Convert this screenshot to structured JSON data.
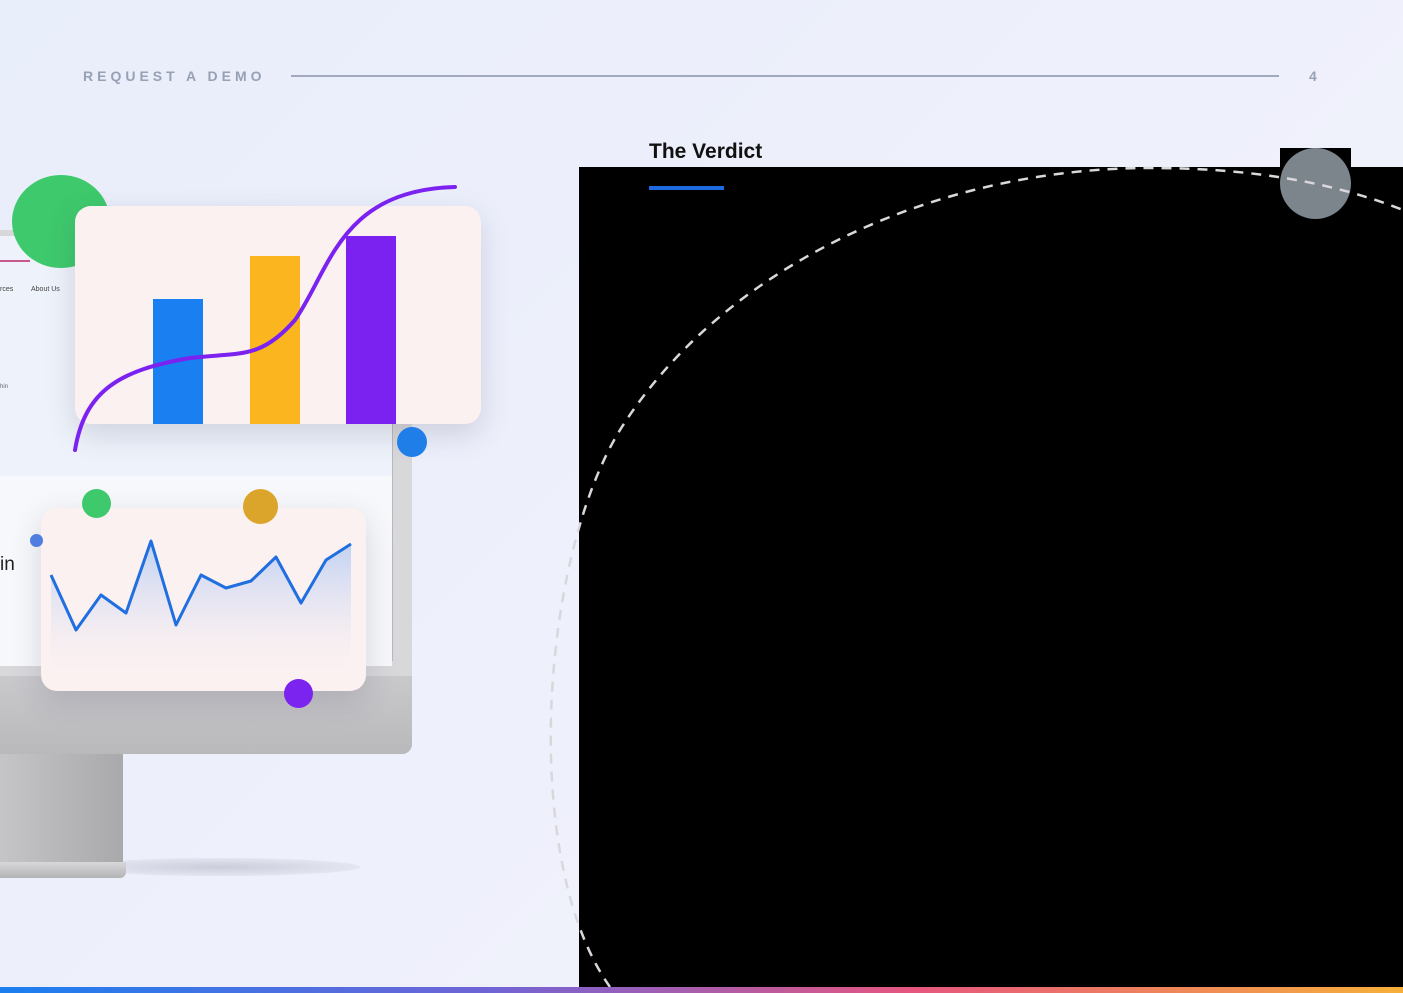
{
  "header": {
    "label": "REQUEST A DEMO",
    "page_number": "4"
  },
  "section": {
    "title": "The Verdict"
  },
  "illustration": {
    "screen_nav": [
      "rces",
      "About Us"
    ],
    "screen_small_text": "hin",
    "screen_big_text": "in"
  },
  "colors": {
    "accent_blue": "#1f6ae0",
    "bar_blue": "#1a7ff0",
    "bar_yellow": "#fbb61f",
    "bar_purple": "#7b22f0",
    "line_blue": "#1f6fe0",
    "green": "#3ec96c"
  },
  "chart_data": [
    {
      "type": "bar",
      "categories": [
        "",
        "",
        ""
      ],
      "values": [
        125,
        168,
        188
      ],
      "ylim": [
        0,
        220
      ],
      "colors": [
        "#1a7ff0",
        "#fbb61f",
        "#7b22f0"
      ],
      "overlay_curve": "s-shaped rising trend line",
      "title": "",
      "xlabel": "",
      "ylabel": ""
    },
    {
      "type": "area",
      "x": [
        0,
        1,
        2,
        3,
        4,
        5,
        6,
        7,
        8,
        9,
        10,
        11,
        12
      ],
      "values": [
        60,
        5,
        40,
        22,
        94,
        10,
        60,
        47,
        54,
        78,
        32,
        75,
        91
      ],
      "ylim": [
        0,
        100
      ],
      "title": "",
      "xlabel": "",
      "ylabel": ""
    }
  ],
  "icons": [
    "gray-circle-icon"
  ]
}
